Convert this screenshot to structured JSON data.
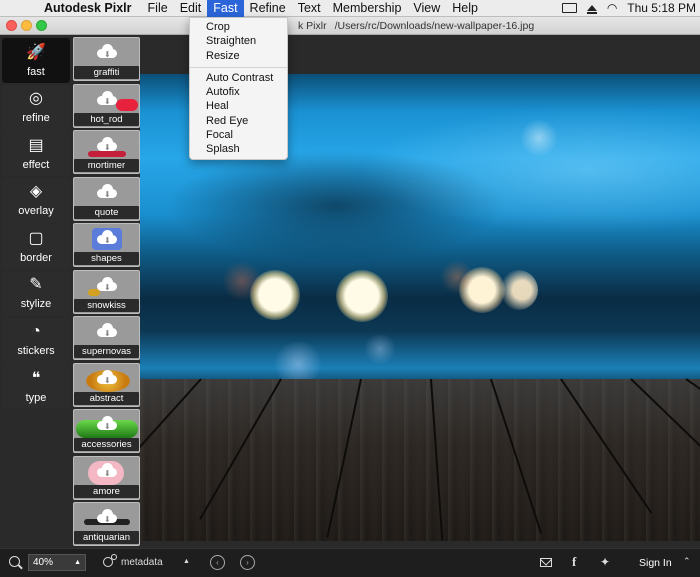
{
  "menubar": {
    "app_name": "Autodesk Pixlr",
    "items": [
      "File",
      "Edit",
      "Fast",
      "Refine",
      "Text",
      "Membership",
      "View",
      "Help"
    ],
    "active_item": "Fast",
    "clock": "Thu 5:18 PM"
  },
  "window": {
    "title": "k Pixlr",
    "path": "/Users/rc/Downloads/new-wallpaper-16.jpg"
  },
  "fast_menu": {
    "group1": [
      "Crop",
      "Straighten",
      "Resize"
    ],
    "group2": [
      "Auto Contrast",
      "Autofix",
      "Heal",
      "Red Eye",
      "Focal",
      "Splash"
    ]
  },
  "tools": [
    {
      "label": "fast",
      "icon": "rocket-icon",
      "glyph": "🚀"
    },
    {
      "label": "refine",
      "icon": "refine-icon",
      "glyph": "◎"
    },
    {
      "label": "effect",
      "icon": "film-icon",
      "glyph": "▤"
    },
    {
      "label": "overlay",
      "icon": "layers-icon",
      "glyph": "◈"
    },
    {
      "label": "border",
      "icon": "border-icon",
      "glyph": "▢"
    },
    {
      "label": "stylize",
      "icon": "brush-icon",
      "glyph": "✎"
    },
    {
      "label": "stickers",
      "icon": "sticker-icon",
      "glyph": "◔"
    },
    {
      "label": "type",
      "icon": "quote-icon",
      "glyph": "❝"
    }
  ],
  "thumbnails": [
    {
      "label": "graffiti"
    },
    {
      "label": "hot_rod"
    },
    {
      "label": "mortimer"
    },
    {
      "label": "quote"
    },
    {
      "label": "shapes"
    },
    {
      "label": "snowkiss"
    },
    {
      "label": "supernovas"
    },
    {
      "label": "abstract"
    },
    {
      "label": "accessories"
    },
    {
      "label": "amore"
    },
    {
      "label": "antiquarian"
    }
  ],
  "bottombar": {
    "zoom": "40%",
    "metadata_label": "metadata",
    "signin_label": "Sign In"
  },
  "colors": {
    "menu_highlight": "#2b65d9",
    "panel_bg": "#2c2c2c",
    "workspace_bg": "#2a2a2a"
  }
}
